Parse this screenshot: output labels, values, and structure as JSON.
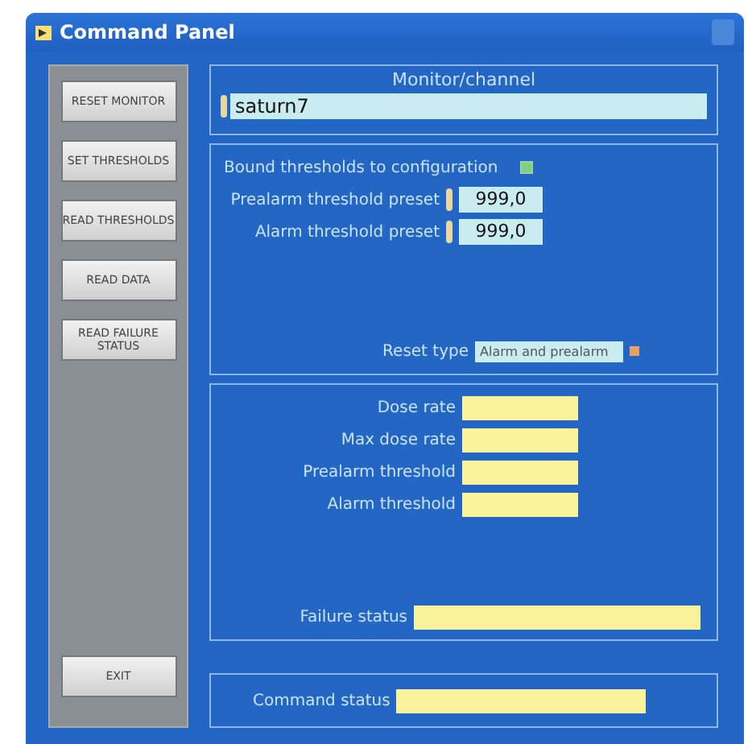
{
  "window": {
    "title": "Command Panel"
  },
  "sidebar": {
    "buttons": [
      "RESET MONITOR",
      "SET THRESHOLDS",
      "READ THRESHOLDS",
      "READ DATA",
      "READ FAILURE STATUS"
    ],
    "exit": "EXIT"
  },
  "monitor": {
    "label": "Monitor/channel",
    "value": "saturn7"
  },
  "thresholds": {
    "bound_label": "Bound thresholds to configuration",
    "bound_checked": true,
    "presets": [
      {
        "label": "Prealarm threshold preset",
        "value": "999,0"
      },
      {
        "label": "Alarm threshold preset",
        "value": "999,0"
      }
    ],
    "reset_label": "Reset type",
    "reset_value": "Alarm and prealarm"
  },
  "readings": {
    "fields": [
      "Dose rate",
      "Max dose rate",
      "Prealarm threshold",
      "Alarm threshold"
    ],
    "failure_label": "Failure status"
  },
  "command_status": {
    "label": "Command status"
  }
}
